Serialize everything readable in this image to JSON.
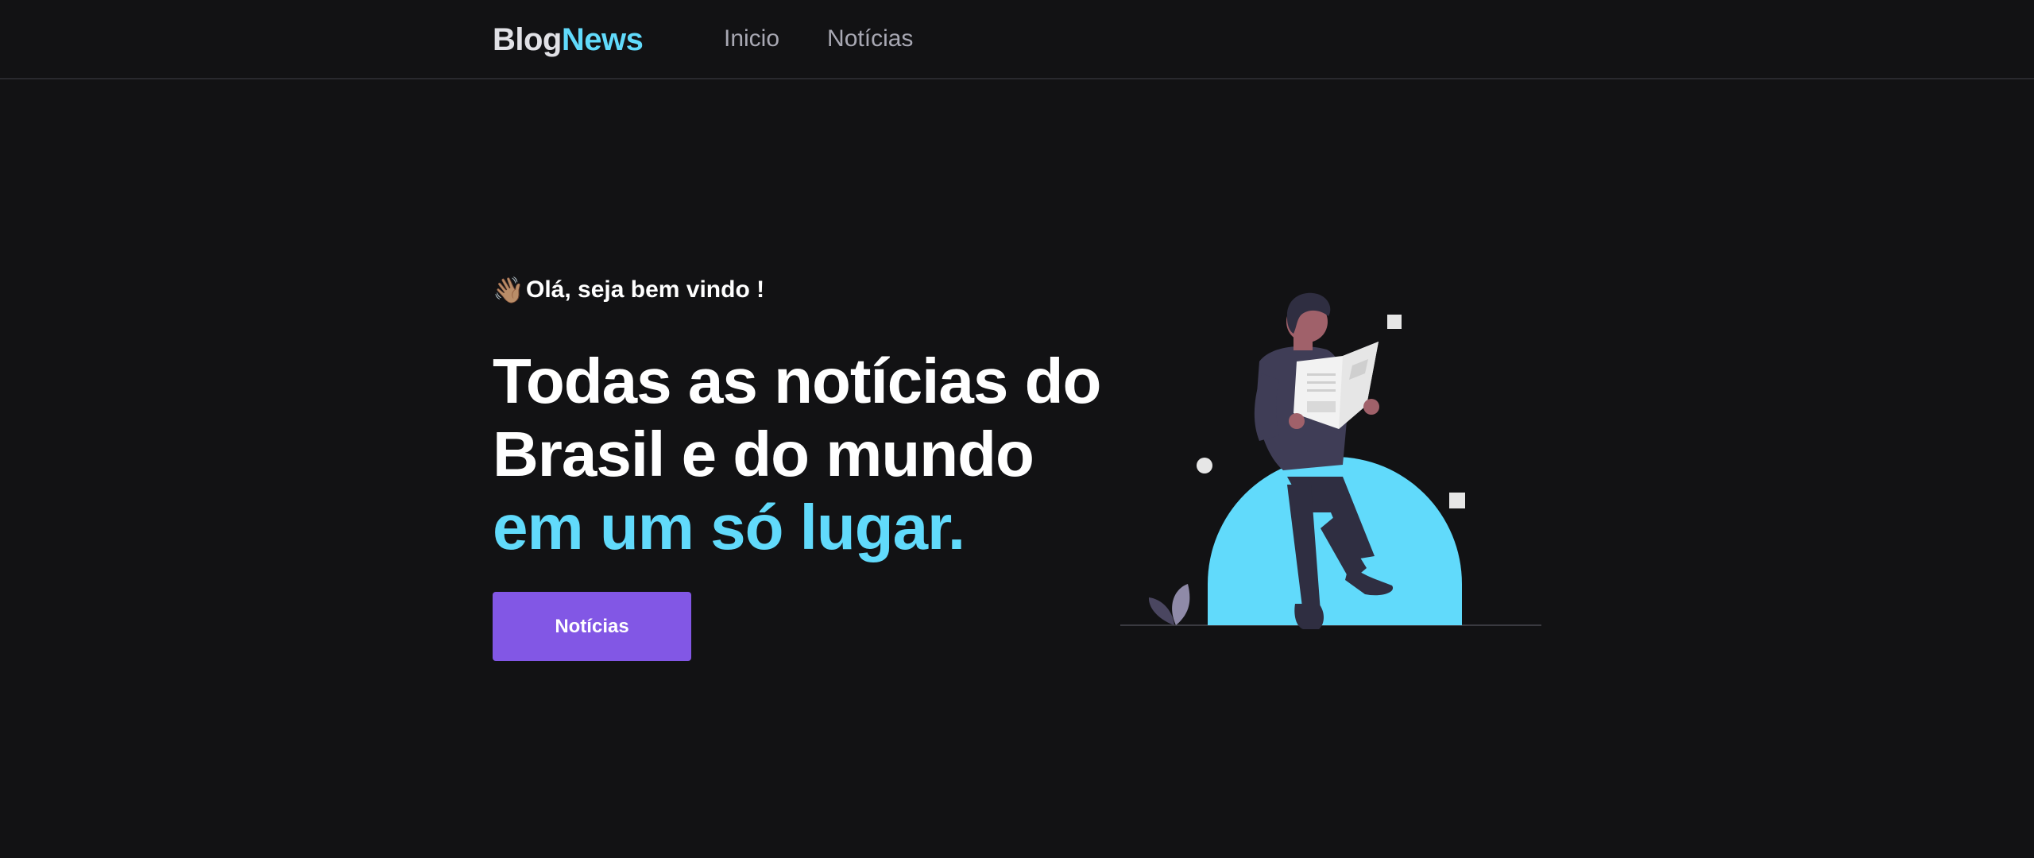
{
  "header": {
    "logo_part1": "Blog",
    "logo_part2": "News",
    "nav": [
      {
        "label": "Inicio"
      },
      {
        "label": "Notícias"
      }
    ]
  },
  "hero": {
    "greeting_emoji": "👋🏽",
    "greeting": "Olá, seja bem vindo !",
    "headline_line1": "Todas as notícias do",
    "headline_line2": "Brasil e do mundo",
    "headline_accent": "em um só lugar.",
    "cta_label": "Notícias",
    "illustration_icon": "person-reading-newspaper"
  },
  "colors": {
    "background": "#121214",
    "accent": "#61dafb",
    "button": "#8257e5",
    "nav_text": "#a8a8b3"
  }
}
